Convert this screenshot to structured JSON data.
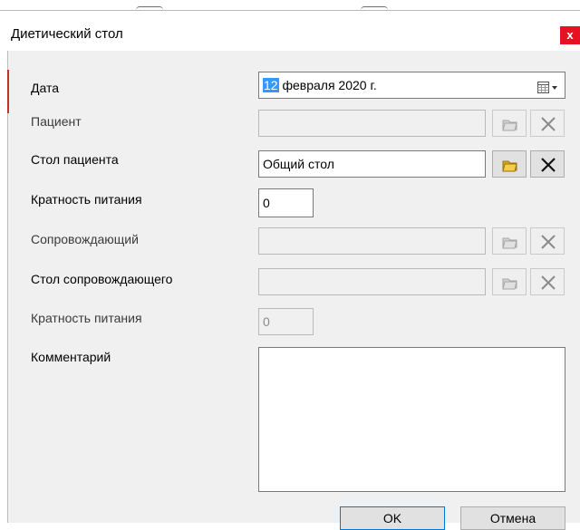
{
  "dialog": {
    "title": "Диетический стол",
    "close_label": "x"
  },
  "fields": {
    "date": {
      "label": "Дата",
      "day": "12",
      "rest": " февраля  2020 г."
    },
    "patient": {
      "label": "Пациент",
      "value": ""
    },
    "patient_table": {
      "label": "Стол пациента",
      "value": "Общий стол"
    },
    "meal_frequency": {
      "label": "Кратность питания",
      "value": "0"
    },
    "companion": {
      "label": "Сопровождающий",
      "value": ""
    },
    "companion_table": {
      "label": "Стол сопровождающего",
      "value": ""
    },
    "companion_meal_frequency": {
      "label": "Кратность питания",
      "value": "0"
    },
    "comment": {
      "label": "Комментарий",
      "value": ""
    }
  },
  "buttons": {
    "ok": "OK",
    "cancel": "Отмена"
  },
  "icons": {
    "calendar": "calendar-dropdown-icon",
    "lookup": "folders-lookup-icon",
    "clear": "x-clear-icon"
  },
  "colors": {
    "close_button": "#e81123",
    "selection": "#3399ff",
    "lookup_icon_active": "#e6c22e",
    "dialog_bg": "#f0f0f0"
  }
}
